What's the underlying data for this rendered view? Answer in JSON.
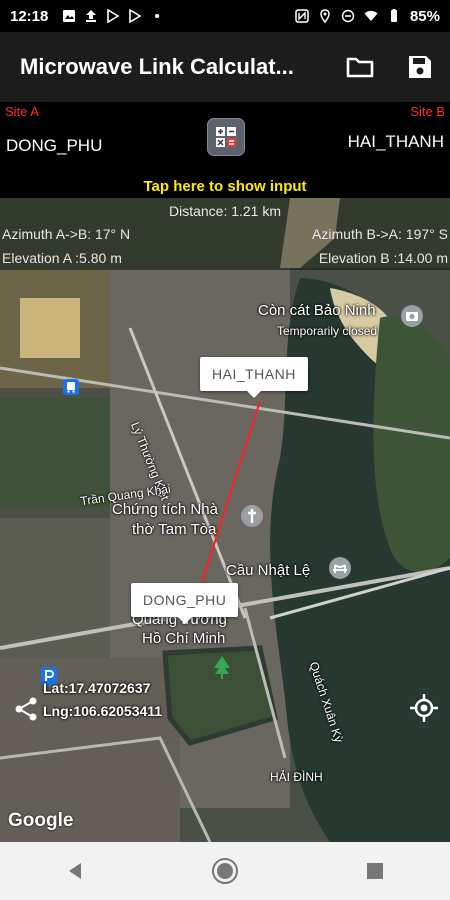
{
  "status": {
    "time": "12:18",
    "battery": "85%"
  },
  "appbar": {
    "title": "Microwave Link Calculat...",
    "open_icon": "folder-icon",
    "save_icon": "save-icon"
  },
  "sites": {
    "a_label": "Site A",
    "b_label": "Site B",
    "a_name": "DONG_PHU",
    "b_name": "HAI_THANH"
  },
  "tap_input": "Tap here to show input",
  "info": {
    "distance": "Distance: 1.21 km",
    "azimuth_a": "Azimuth A->B: 17° N",
    "azimuth_b": "Azimuth B->A: 197° S",
    "elevation_a": "Elevation A :5.80 m",
    "elevation_b": "Elevation B :14.00 m"
  },
  "map": {
    "marker_b": "HAI_THANH",
    "marker_a": "DONG_PHU",
    "poi_1": "Còn cát Bảo Ninh",
    "poi_1_sub": "Temporarily closed",
    "poi_2_line1": "Chứng tích Nhà",
    "poi_2_line2": "thờ Tam Tòa",
    "poi_3": "Cầu Nhật Lệ",
    "poi_4_line1": "Quảng trường",
    "poi_4_line2": "Hồ Chí Minh",
    "street_1": "Lý Thường Kiệt",
    "street_2": "Trần Quang Khải",
    "street_3": "Quách Xuân Kỳ",
    "area": "HẢI ĐÌNH",
    "lat": "Lat:17.47072637",
    "lng": "Lng:106.62053411",
    "google": "Google"
  }
}
